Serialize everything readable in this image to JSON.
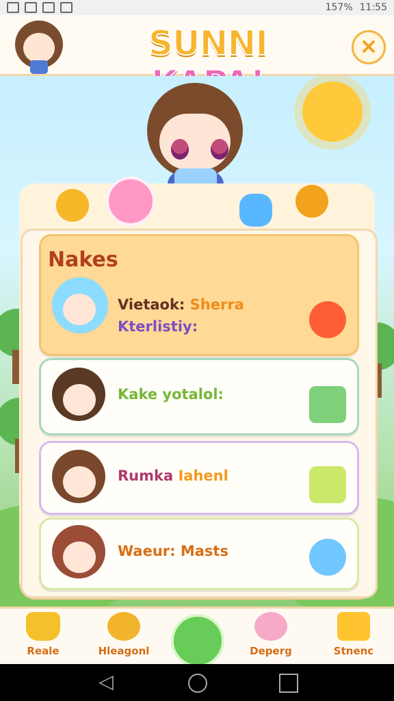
{
  "status_bar": {
    "battery": "157%",
    "time": "11:55"
  },
  "header": {
    "title_part1": "SUNNI",
    "title_part2": "KAPA!"
  },
  "section_title": "Nakes",
  "cards": [
    {
      "line1_prefix": "Vietaok:",
      "line1_accent": "Sherra",
      "line2": "Kterlistiy:"
    },
    {
      "text": "Kake yotalol:"
    },
    {
      "text_prefix": "Rumka",
      "text_accent": "Iahenl"
    },
    {
      "text": "Waeur: Masts"
    }
  ],
  "bottom_nav": [
    {
      "label": "Reale"
    },
    {
      "label": "Hleagonl"
    },
    {
      "label": "Deperg"
    },
    {
      "label": "Stnenc"
    }
  ],
  "colors": {
    "accent_orange": "#f08c18",
    "panel": "#fff0da",
    "featured": "#ffd996"
  }
}
